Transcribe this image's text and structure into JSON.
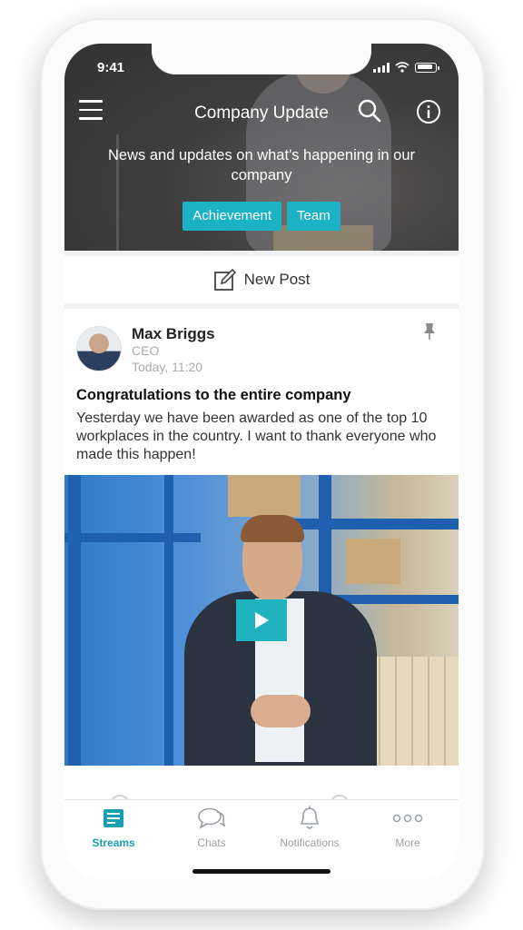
{
  "status_bar": {
    "time": "9:41"
  },
  "header": {
    "title": "Company Update",
    "description": "News and updates on what's happening in our company",
    "tags": [
      "Achievement",
      "Team"
    ]
  },
  "new_post": {
    "label": "New Post"
  },
  "post": {
    "author": "Max Briggs",
    "role": "CEO",
    "time": "Today, 11:20",
    "title": "Congratulations to the entire company",
    "body": "Yesterday we have been awarded as one of the top 10 workplaces in the country. I want to thank everyone who made this happen!"
  },
  "tabbar": {
    "items": [
      {
        "label": "Streams",
        "icon": "streams-icon",
        "active": true
      },
      {
        "label": "Chats",
        "icon": "chat-icon",
        "active": false
      },
      {
        "label": "Notifications",
        "icon": "bell-icon",
        "active": false
      },
      {
        "label": "More",
        "icon": "more-icon",
        "active": false
      }
    ]
  },
  "colors": {
    "accent": "#1bb3c3",
    "active_tab": "#1a9fb0"
  }
}
